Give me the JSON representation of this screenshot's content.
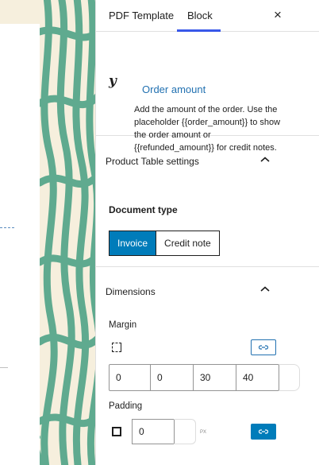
{
  "tabs": {
    "pdf_template": "PDF Template",
    "block": "Block",
    "close": "×"
  },
  "block": {
    "icon": "y",
    "title": "Order amount",
    "description": "Add the amount of the order. Use the placeholder {{order_amount}} to show the order amount or {{refunded_amount}} for credit notes."
  },
  "product_table": {
    "title": "Product Table settings",
    "document_type_label": "Document type",
    "options": [
      "Invoice",
      "Credit note"
    ],
    "selected": "Invoice"
  },
  "dimensions": {
    "title": "Dimensions",
    "margin_label": "Margin",
    "margin_values": [
      "0",
      "0",
      "30",
      "40"
    ],
    "padding_label": "Padding",
    "padding_value": "0",
    "padding_unit": "PX"
  },
  "colors": {
    "accent": "#007cba",
    "link": "#2271b1",
    "tab_indicator": "#3858e9",
    "canvas_bg": "#f6efdd",
    "canvas_pattern": "#5faa8f"
  }
}
